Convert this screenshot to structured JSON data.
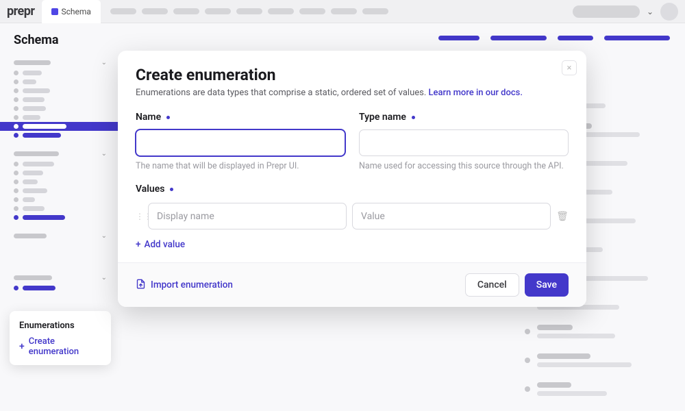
{
  "brand": "prepr",
  "nav": {
    "active_tab": "Schema"
  },
  "sidebar": {
    "title": "Schema"
  },
  "popover": {
    "title": "Enumerations",
    "action": "Create enumeration"
  },
  "dialog": {
    "title": "Create enumeration",
    "description": "Enumerations are data types that comprise a static, ordered set of values.",
    "learn_more": "Learn more in our docs.",
    "name_label": "Name",
    "name_hint": "The name that will be displayed in Prepr UI.",
    "type_name_label": "Type name",
    "type_name_hint": "Name used for accessing this source through the API.",
    "values_label": "Values",
    "display_name_placeholder": "Display name",
    "value_placeholder": "Value",
    "add_value": "Add value",
    "import": "Import enumeration",
    "cancel": "Cancel",
    "save": "Save"
  }
}
